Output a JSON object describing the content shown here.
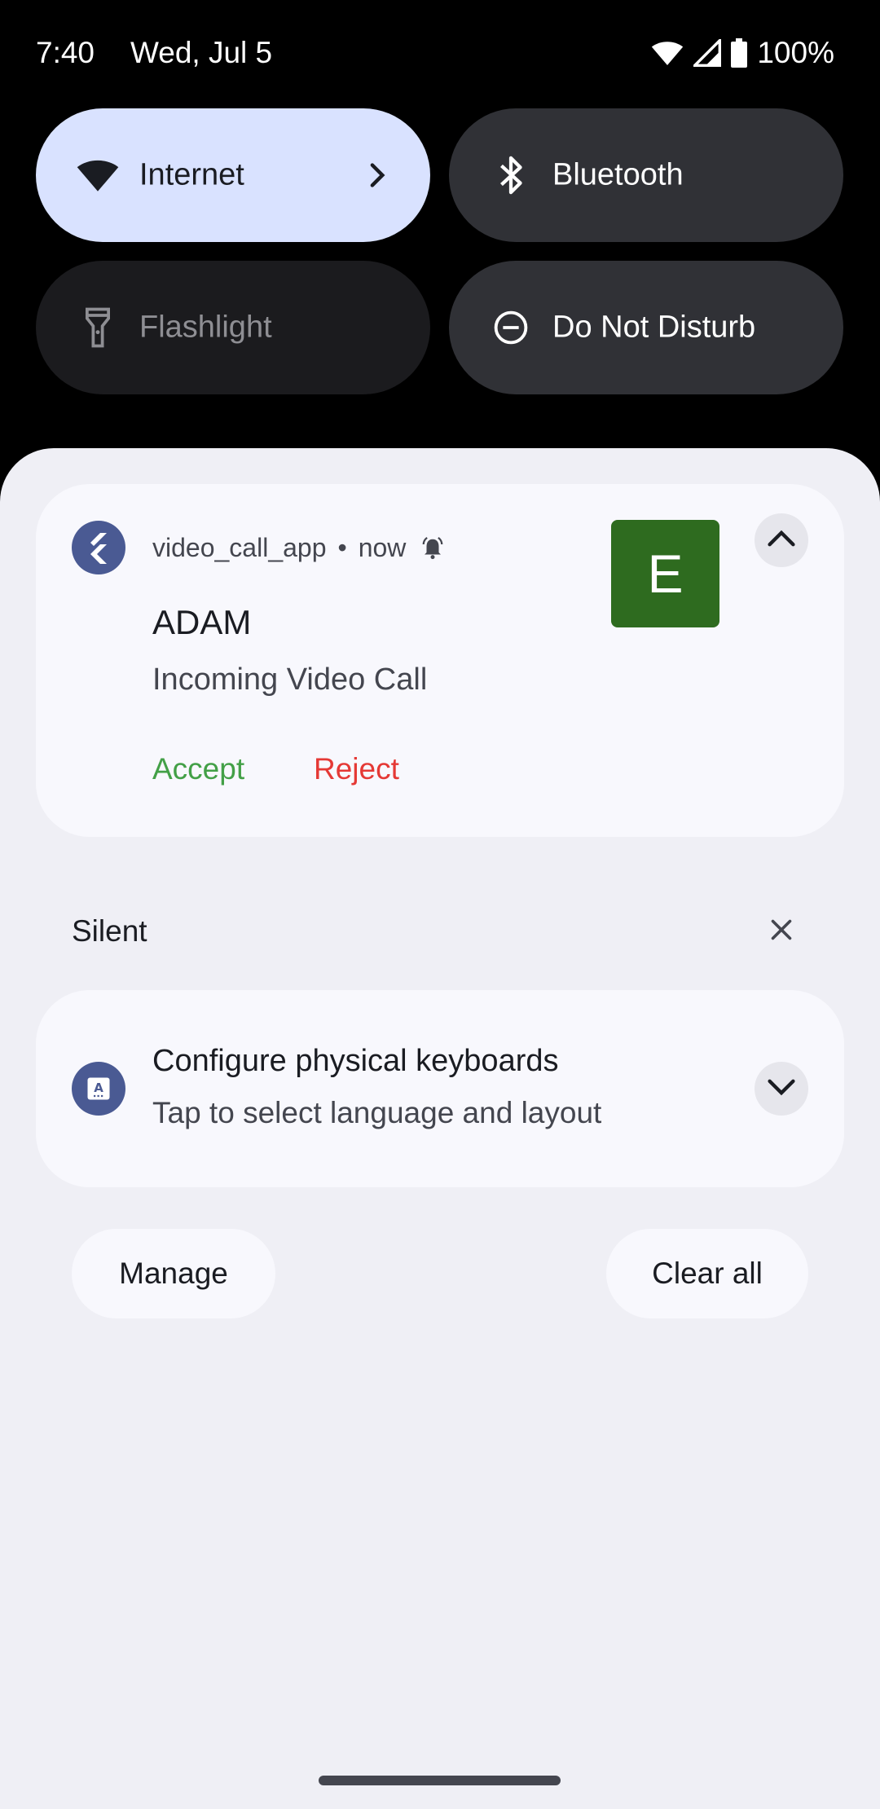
{
  "status_bar": {
    "time": "7:40",
    "date": "Wed, Jul 5",
    "battery": "100%",
    "icons": [
      "wifi-icon",
      "cell-signal-icon",
      "battery-icon"
    ]
  },
  "quick_settings": {
    "tiles": [
      {
        "label": "Internet",
        "icon": "wifi-icon",
        "state": "active"
      },
      {
        "label": "Bluetooth",
        "icon": "bluetooth-icon",
        "state": "off"
      },
      {
        "label": "Flashlight",
        "icon": "flashlight-icon",
        "state": "unavailable"
      },
      {
        "label": "Do Not Disturb",
        "icon": "do-not-disturb-icon",
        "state": "off"
      }
    ]
  },
  "notifications": {
    "call": {
      "app_name": "video_call_app",
      "separator": "•",
      "time": "now",
      "title": "ADAM",
      "text": "Incoming Video Call",
      "avatar_letter": "E",
      "actions": {
        "accept": "Accept",
        "reject": "Reject"
      }
    },
    "silent_section": {
      "label": "Silent"
    },
    "keyboard": {
      "title": "Configure physical keyboards",
      "text": "Tap to select language and layout"
    }
  },
  "footer": {
    "manage_label": "Manage",
    "clear_all_label": "Clear all"
  },
  "colors": {
    "accept": "#43a047",
    "reject": "#e53935",
    "avatar_bg": "#2e6b1f",
    "app_icon_bg": "#4a5a93",
    "internet_tile_bg": "#d9e2ff"
  }
}
